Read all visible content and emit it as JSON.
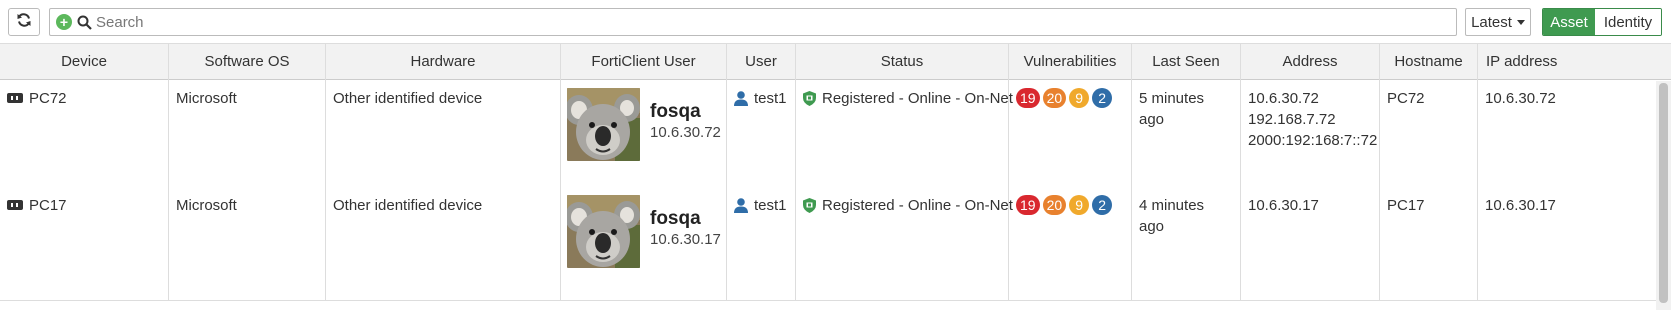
{
  "toolbar": {
    "refresh_icon": "refresh-icon",
    "add_icon": "plus-circle-icon",
    "search_icon": "search-icon",
    "search_placeholder": "Search",
    "search_value": "",
    "view_select_label": "Latest",
    "view_modes": [
      "Asset",
      "Identity"
    ],
    "active_view_mode": "Asset",
    "accent_color": "#3f9a50"
  },
  "table": {
    "columns": [
      "Device",
      "Software OS",
      "Hardware",
      "FortiClient User",
      "User",
      "Status",
      "Vulnerabilities",
      "Last Seen",
      "Address",
      "Hostname",
      "IP address"
    ],
    "rows": [
      {
        "device": "PC72",
        "software_os": "Microsoft",
        "hardware": "Other identified device",
        "forticlient_user": {
          "name": "fosqa",
          "ip": "10.6.30.72",
          "avatar_icon": "koala-avatar"
        },
        "user": "test1",
        "status": "Registered - Online - On-Net",
        "vulnerabilities": [
          {
            "count": "19",
            "color": "#d9282f"
          },
          {
            "count": "20",
            "color": "#e8812e"
          },
          {
            "count": "9",
            "color": "#f0a92c"
          },
          {
            "count": "2",
            "color": "#2f6da8"
          }
        ],
        "last_seen": "5 minutes ago",
        "address": [
          "10.6.30.72",
          "192.168.7.72",
          "2000:192:168:7::72"
        ],
        "hostname": "PC72",
        "ip_address": "10.6.30.72"
      },
      {
        "device": "PC17",
        "software_os": "Microsoft",
        "hardware": "Other identified device",
        "forticlient_user": {
          "name": "fosqa",
          "ip": "10.6.30.17",
          "avatar_icon": "koala-avatar"
        },
        "user": "test1",
        "status": "Registered - Online - On-Net",
        "vulnerabilities": [
          {
            "count": "19",
            "color": "#d9282f"
          },
          {
            "count": "20",
            "color": "#e8812e"
          },
          {
            "count": "9",
            "color": "#f0a92c"
          },
          {
            "count": "2",
            "color": "#2f6da8"
          }
        ],
        "last_seen": "4 minutes ago",
        "address": [
          "10.6.30.17"
        ],
        "hostname": "PC17",
        "ip_address": "10.6.30.17"
      }
    ]
  }
}
